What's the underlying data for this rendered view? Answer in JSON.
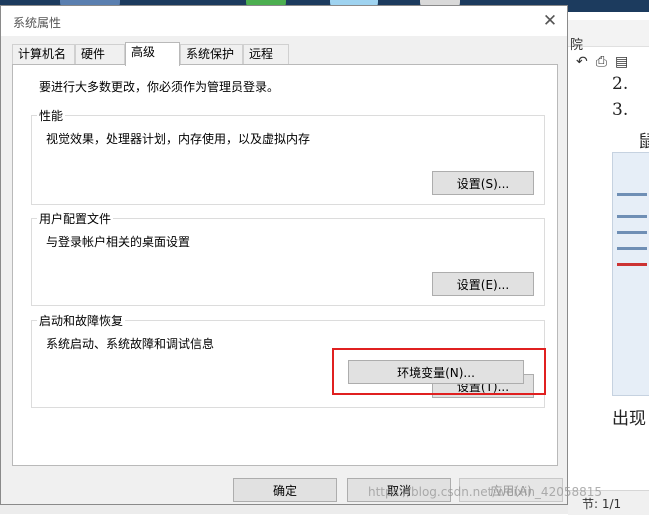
{
  "dialog": {
    "title": "系统属性",
    "close_icon": "close-icon",
    "tabs": [
      {
        "label": "计算机名",
        "active": false
      },
      {
        "label": "硬件",
        "active": false
      },
      {
        "label": "高级",
        "active": true
      },
      {
        "label": "系统保护",
        "active": false
      },
      {
        "label": "远程",
        "active": false
      }
    ],
    "admin_note": "要进行大多数更改，你必须作为管理员登录。",
    "groups": {
      "performance": {
        "title": "性能",
        "description": "视觉效果，处理器计划，内存使用，以及虚拟内存",
        "button": "设置(S)..."
      },
      "user_profiles": {
        "title": "用户配置文件",
        "description": "与登录帐户相关的桌面设置",
        "button": "设置(E)..."
      },
      "startup_recovery": {
        "title": "启动和故障恢复",
        "description": "系统启动、系统故障和调试信息",
        "button": "设置(T)..."
      }
    },
    "env_button": "环境变量(N)...",
    "env_highlight_color": "#e02020",
    "footer": {
      "ok": "确定",
      "cancel": "取消",
      "apply": "应用(A)"
    }
  },
  "background_window": {
    "tab_fragment": "院",
    "toolbar_icons": [
      "undo-icon",
      "print-icon",
      "printer-icon"
    ],
    "list_numbers": [
      "2.",
      "3."
    ],
    "text_fragment_1": "鼠",
    "text_fragment_2": "出现",
    "status": "节: 1/1"
  },
  "watermark": "https://blog.csdn.net/weixin_42058815"
}
